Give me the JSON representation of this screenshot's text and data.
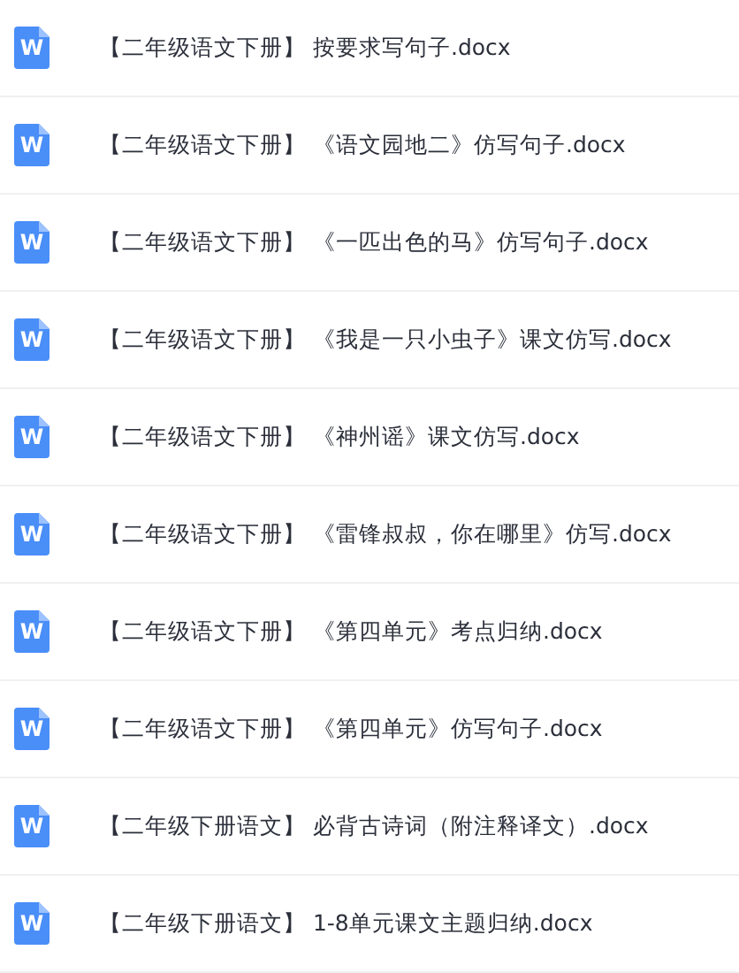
{
  "files": [
    {
      "icon_letter": "W",
      "name": "【二年级语文下册】 按要求写句子.docx"
    },
    {
      "icon_letter": "W",
      "name": "【二年级语文下册】 《语文园地二》仿写句子.docx"
    },
    {
      "icon_letter": "W",
      "name": "【二年级语文下册】 《一匹出色的马》仿写句子.docx"
    },
    {
      "icon_letter": "W",
      "name": "【二年级语文下册】 《我是一只小虫子》课文仿写.docx"
    },
    {
      "icon_letter": "W",
      "name": "【二年级语文下册】 《神州谣》课文仿写.docx"
    },
    {
      "icon_letter": "W",
      "name": "【二年级语文下册】 《雷锋叔叔，你在哪里》仿写.docx"
    },
    {
      "icon_letter": "W",
      "name": "【二年级语文下册】 《第四单元》考点归纳.docx"
    },
    {
      "icon_letter": "W",
      "name": "【二年级语文下册】 《第四单元》仿写句子.docx"
    },
    {
      "icon_letter": "W",
      "name": "【二年级下册语文】 必背古诗词（附注释译文）.docx"
    },
    {
      "icon_letter": "W",
      "name": "【二年级下册语文】 1-8单元课文主题归纳.docx"
    }
  ]
}
